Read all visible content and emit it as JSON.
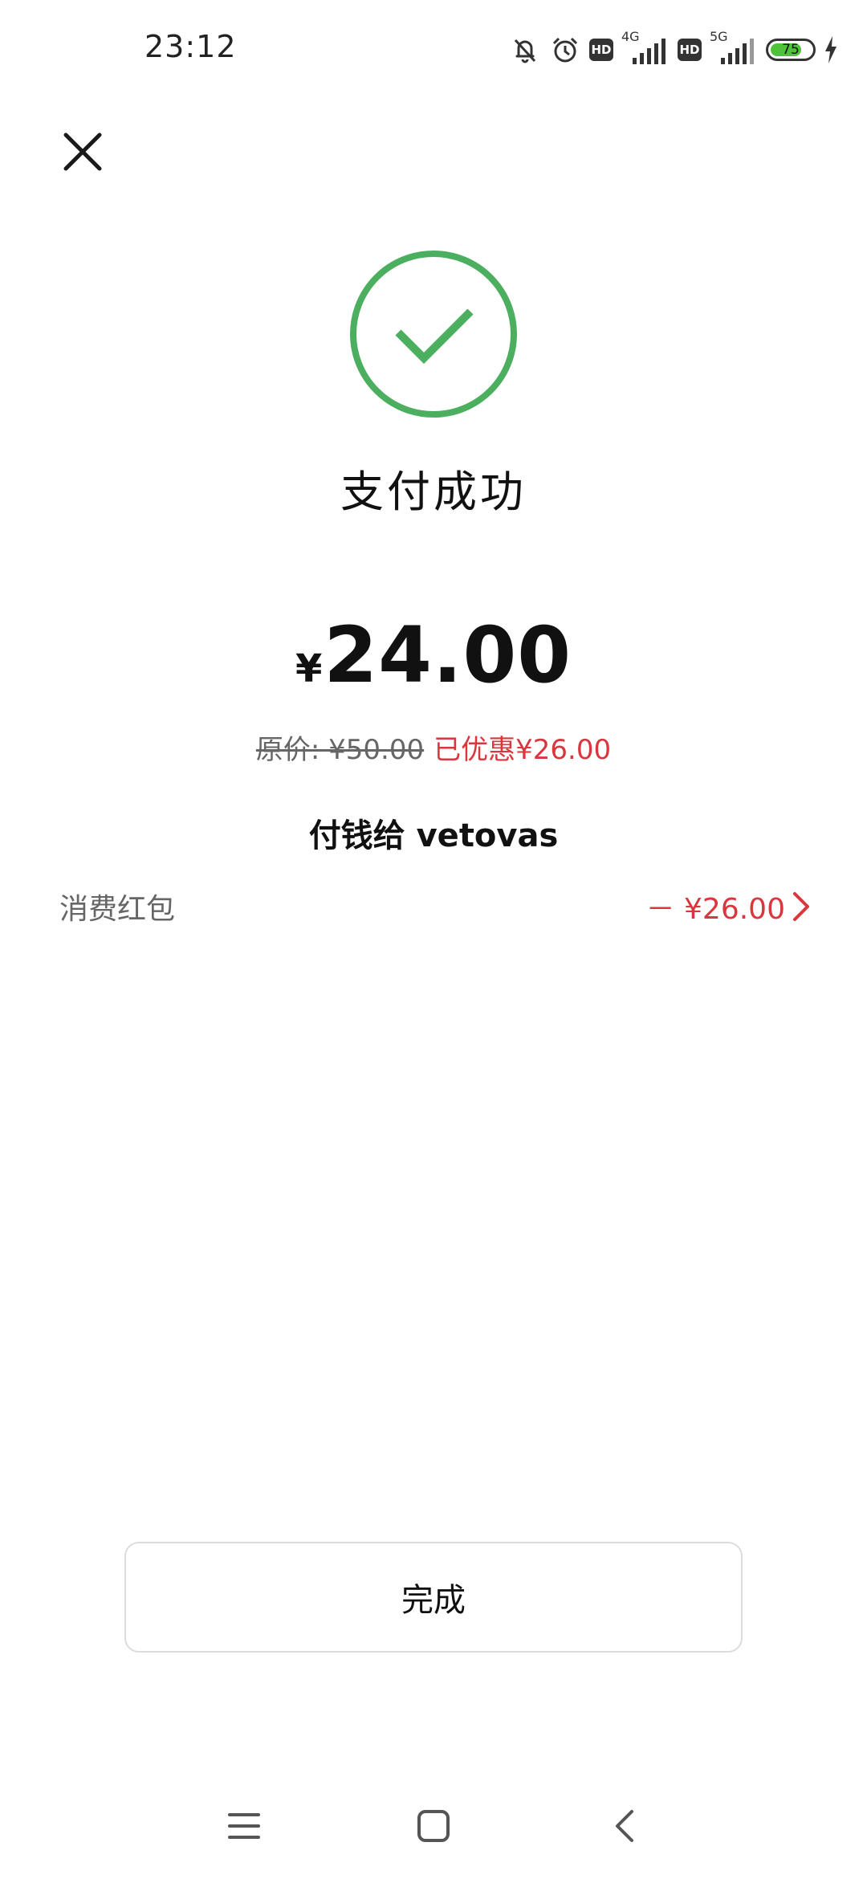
{
  "status_bar": {
    "time": "23:12",
    "network_1": "4G",
    "network_2": "5G",
    "hd_label": "HD",
    "battery_percent": "75",
    "battery_level": 0.75,
    "icons": [
      "mute-bell-icon",
      "alarm-icon",
      "hd-icon",
      "signal-icon",
      "hd-icon",
      "signal-icon",
      "battery-icon",
      "charging-icon"
    ]
  },
  "header": {
    "close_icon": "close-icon"
  },
  "result": {
    "icon": "check-circle-icon",
    "title": "支付成功",
    "currency": "¥",
    "amount": "24.00",
    "original_price": "原价: ¥50.00",
    "discount": "已优惠¥26.00",
    "payee": "付钱给 vetovas"
  },
  "coupon": {
    "label": "消费红包",
    "amount": "－ ¥26.00",
    "icon": "chevron-right-icon"
  },
  "actions": {
    "done_label": "完成"
  },
  "nav": {
    "icons": [
      "menu-icon",
      "home-icon",
      "back-icon"
    ]
  },
  "colors": {
    "success_green": "#4caf60",
    "discount_red": "#d9363e",
    "battery_green": "#4fc23a"
  }
}
